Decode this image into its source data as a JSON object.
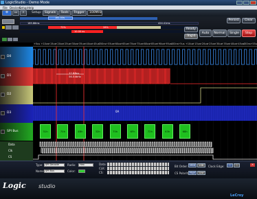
{
  "window": {
    "title": "LogicStudio - Demo Mode"
  },
  "menu": [
    "File",
    "Devices",
    "Setup",
    "Help"
  ],
  "toolbar": {
    "setup_label": "Setup:",
    "signals": "Signals",
    "tools": "Tools",
    "trigger": "Trigger",
    "speed": "100MHz"
  },
  "controls": {
    "ready": "Ready",
    "trig": "Trig'd",
    "auto": "Auto",
    "normal": "Normal",
    "single": "Single",
    "stop": "Stop",
    "persist": "Persist",
    "clear": "Clear",
    "cursor_a": "185.88ms",
    "cursor_a_pct": "72%",
    "cursor_b_value": "424.41ms",
    "timebase": "10.00 ns",
    "offset": "181.53s",
    "t_value": "28%"
  },
  "ruler": {
    "ticks": [
      "+5us",
      "+10us",
      "+15us",
      "+20us",
      "+25us",
      "+30us",
      "+35us",
      "+40us",
      "+45us",
      "350ns",
      "+55us",
      "+60us",
      "+65us",
      "+70us",
      "+75us",
      "+80us",
      "+85us",
      "+90us",
      "+95us",
      "400ns",
      "+5us",
      "+10us",
      "+15us",
      "+20us",
      "+25us",
      "+30us",
      "+35us",
      "+40us",
      "+45us",
      "450ns",
      "+55us"
    ]
  },
  "channels": [
    {
      "name": "D0",
      "color": "#1e88e5"
    },
    {
      "name": "D1",
      "color": "#e53935"
    },
    {
      "name": "D2",
      "color": "#c7c77a"
    },
    {
      "name": "D3",
      "color": "#1a23b8"
    },
    {
      "name": "SPI Bus",
      "color": "#22aa22"
    }
  ],
  "subchannels": [
    "Data",
    "Clk",
    "CS"
  ],
  "annotation": {
    "line1": "17.88us",
    "line2": "56.54kHz"
  },
  "bus_center_value": "0A",
  "bus_values": [
    "31h",
    "70h",
    "4Bh",
    "32h",
    "75h",
    "6Fh",
    "72h",
    "63h",
    "68h"
  ],
  "decode": {
    "type_label": "Type:",
    "type_value": "SPI Decode",
    "radix_label": "Radix:",
    "radix_value": "Hex",
    "name_label": "Name:",
    "name_value": "SPI Bus",
    "color_label": "Color:",
    "data_label": "Data:",
    "clk_label": "CLK:",
    "cs_label": "CS:",
    "bit_order_label": "Bit Order:",
    "msb": "MSB",
    "lsb": "LSB",
    "clock_edge_label": "Clock Edge:",
    "cs_polarity_label": "CS Polarity:",
    "high": "High",
    "low": "Low"
  },
  "footer": {
    "logo_a": "Logic",
    "logo_b": "studio",
    "brand": "LeCroy"
  }
}
